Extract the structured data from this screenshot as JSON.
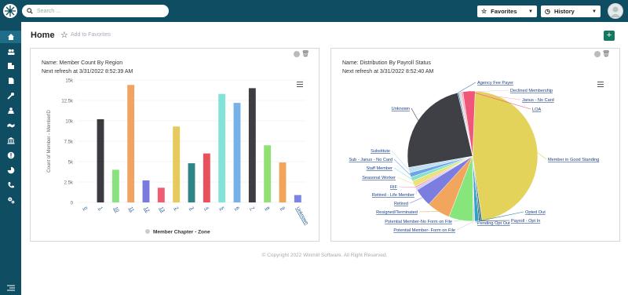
{
  "search": {
    "placeholder": "Search ..."
  },
  "header": {
    "favorites_label": "Favorites",
    "history_label": "History"
  },
  "page": {
    "title": "Home",
    "add_to_favorites": "Add to Favorites"
  },
  "sidebar": {
    "icons": [
      "home-icon",
      "users-icon",
      "building-icon",
      "document-icon",
      "tools-icon",
      "team-icon",
      "handshake-icon",
      "bank-icon",
      "info-icon",
      "pie-chart-icon",
      "phone-icon",
      "settings-icon"
    ]
  },
  "card1": {
    "name": "Name: Member Count By Region",
    "refresh": "Next refresh at 3/31/2022 8:52:39 AM"
  },
  "card2": {
    "name": "Name: Distribution By Payroll Status",
    "refresh": "Next refresh at 3/31/2022 8:52:40 AM"
  },
  "footer": {
    "copyright": "© Copyright 2022 Winmill Software. All Right Reserved."
  },
  "colors": {
    "topbar": "#0f4d63",
    "accent": "#14795f"
  },
  "chart_data": [
    {
      "type": "bar",
      "title": "",
      "ylabel": "Count of Member - MemberID",
      "xlabel": "",
      "legend": "Member Chapter - Zone",
      "legend_position": "bottom",
      "ylim": [
        0,
        15000
      ],
      "yticks": [
        "0",
        "2.5k",
        "5k",
        "7.5k",
        "10k",
        "12.5k",
        "15k"
      ],
      "categories": [
        "0",
        "1",
        "10",
        "11",
        "12",
        "13",
        "2",
        "3",
        "4",
        "5",
        "6",
        "7",
        "8",
        "9",
        "Unknown"
      ],
      "values": [
        0,
        10200,
        4000,
        14400,
        2700,
        1800,
        9300,
        4800,
        6000,
        13300,
        12200,
        14000,
        7000,
        4900,
        900
      ],
      "colors": [
        "#3f3f45",
        "#3a3a40",
        "#88e27d",
        "#f1a462",
        "#7a7ae0",
        "#ef5d73",
        "#e8c95c",
        "#2f8585",
        "#e8505b",
        "#84e3d8",
        "#78b1e8",
        "#3d3d42",
        "#90e074",
        "#f0a55a",
        "#7a84e2"
      ]
    },
    {
      "type": "pie",
      "title": "",
      "labels": [
        "Member in Good Standing",
        "Opted Out",
        "Payroll - Opt In",
        "Pending Opt Out",
        "Potential Member- Form on File",
        "Potential Member-No Form on File",
        "Resigned/Terminated",
        "Retired",
        "Retired - Life Member",
        "RIF",
        "Seasonal Worker",
        "Staff Member",
        "Sub - Janus - No Card",
        "Substitute",
        "Unknown",
        "Agency Fee Payer",
        "Declined Membership",
        "Janus - No Card",
        "LOA"
      ],
      "values": [
        46.8,
        0.5,
        0.3,
        1.0,
        0.4,
        6.0,
        5.8,
        4.5,
        0.6,
        0.4,
        1.5,
        1.0,
        1.1,
        1.3,
        24.0,
        0.3,
        0.5,
        0.5,
        3.0
      ],
      "colors": [
        "#e4d35a",
        "#2e7f9c",
        "#3a3a3a",
        "#2aa3c9",
        "#d0d0d0",
        "#86e57b",
        "#f2a55c",
        "#7c7de0",
        "#c9c9ff",
        "#ff9aa8",
        "#e6e47a",
        "#86e0d0",
        "#6ca4e6",
        "#bfe0f0",
        "#3f3f46",
        "#3c78b0",
        "#d9d9d9",
        "#f7a9b5",
        "#f0567a"
      ]
    }
  ]
}
